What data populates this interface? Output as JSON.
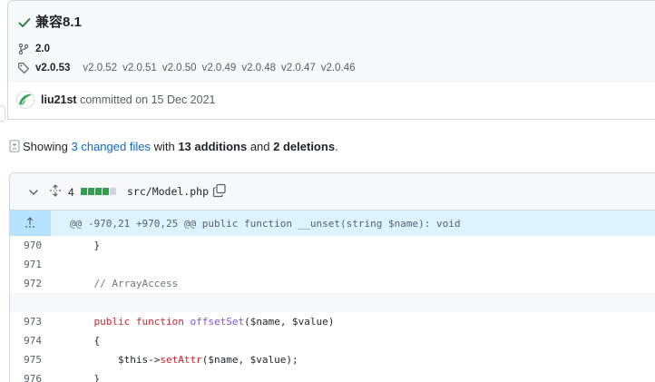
{
  "commit": {
    "title": "兼容8.1",
    "branch": "2.0",
    "current_tag": "v2.0.53",
    "other_tags": [
      "v2.0.52",
      "v2.0.51",
      "v2.0.50",
      "v2.0.49",
      "v2.0.48",
      "v2.0.47",
      "v2.0.46"
    ],
    "author": "liu21st",
    "committed_text": "committed on 15 Dec 2021"
  },
  "summary": {
    "showing": "Showing",
    "changed_files": "3 changed files",
    "with": "with",
    "additions": "13 additions",
    "and": "and",
    "deletions": "2 deletions",
    "end": "."
  },
  "file": {
    "change_count": "4",
    "diffstat": [
      "added",
      "added",
      "added",
      "added",
      "neutral"
    ],
    "path": "src/Model.php",
    "hunk_header": "@@ -970,21 +970,25 @@ public function __unset(string $name): void",
    "lines": [
      {
        "num": "970",
        "code": "    }"
      },
      {
        "num": "971",
        "code": ""
      },
      {
        "num": "972",
        "code": "    // ArrayAccess"
      },
      {
        "num": "973",
        "code_parts": [
          "    ",
          "public function ",
          "offsetSet",
          "($name, $value)"
        ]
      },
      {
        "num": "974",
        "code": "    {"
      },
      {
        "num": "975",
        "code_parts": [
          "        $this->",
          "setAttr",
          "($name, $value);"
        ]
      },
      {
        "num": "976",
        "code": "    }"
      }
    ]
  },
  "colors": {
    "added": "#2da44e",
    "neutral": "#d0d7de",
    "link": "#0969da",
    "check": "#1a7f37"
  }
}
